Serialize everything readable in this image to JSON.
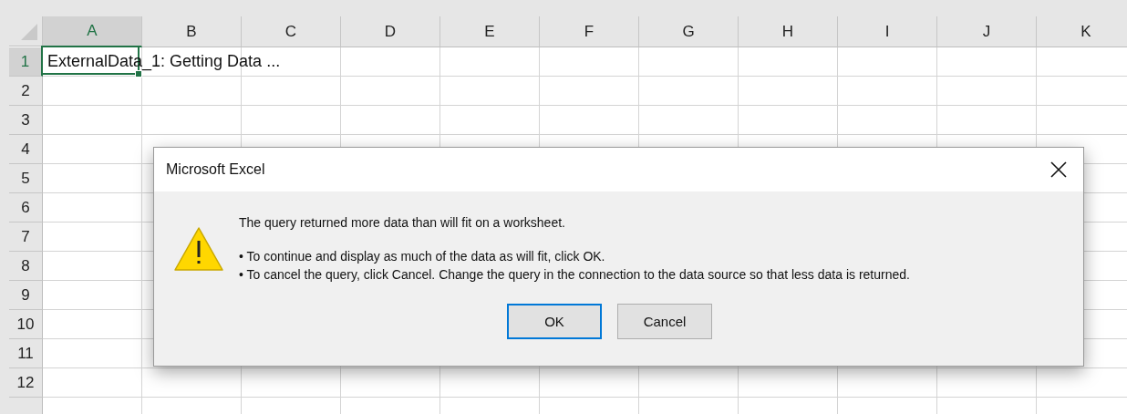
{
  "columns": [
    {
      "label": "A",
      "selected": true
    },
    {
      "label": "B",
      "selected": false
    },
    {
      "label": "C",
      "selected": false
    },
    {
      "label": "D",
      "selected": false
    },
    {
      "label": "E",
      "selected": false
    },
    {
      "label": "F",
      "selected": false
    },
    {
      "label": "G",
      "selected": false
    },
    {
      "label": "H",
      "selected": false
    },
    {
      "label": "I",
      "selected": false
    },
    {
      "label": "J",
      "selected": false
    },
    {
      "label": "K",
      "selected": false
    }
  ],
  "rows": [
    {
      "label": "1",
      "selected": true,
      "cells": [
        {
          "text": "ExternalData_1: Getting Data ...",
          "selected": true
        }
      ]
    },
    {
      "label": "2",
      "selected": false
    },
    {
      "label": "3",
      "selected": false
    },
    {
      "label": "4",
      "selected": false
    },
    {
      "label": "5",
      "selected": false
    },
    {
      "label": "6",
      "selected": false
    },
    {
      "label": "7",
      "selected": false
    },
    {
      "label": "8",
      "selected": false
    },
    {
      "label": "9",
      "selected": false
    },
    {
      "label": "10",
      "selected": false
    },
    {
      "label": "11",
      "selected": false
    },
    {
      "label": "12",
      "selected": false
    }
  ],
  "dialog": {
    "title": "Microsoft Excel",
    "kind": "warning",
    "message": "The query returned more data than will fit on a worksheet.",
    "bullets": [
      "• To continue and display as much of the data as will fit, click OK.",
      "• To cancel the query, click Cancel. Change the query in the connection to the data source so that less data is returned."
    ],
    "buttons": [
      {
        "label": "OK",
        "default": true
      },
      {
        "label": "Cancel",
        "default": false
      }
    ]
  }
}
